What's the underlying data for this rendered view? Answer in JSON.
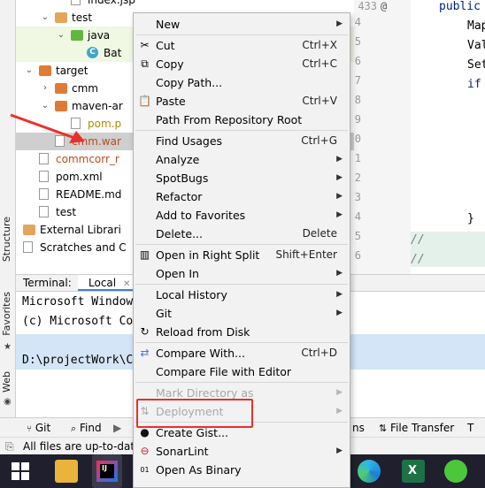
{
  "project_tree": {
    "items": [
      {
        "label": "index.jsp",
        "indent": 2,
        "icon": "jsp-file-icon",
        "expanded": null
      },
      {
        "label": "test",
        "indent": 1,
        "icon": "folder-icon",
        "expanded": true
      },
      {
        "label": "java",
        "indent": 2,
        "icon": "green-folder-icon",
        "expanded": true
      },
      {
        "label": "Bat",
        "indent": 3,
        "icon": "class-icon",
        "expanded": null
      },
      {
        "label": "target",
        "indent": 0,
        "icon": "orange-folder-icon",
        "expanded": true
      },
      {
        "label": "cmm",
        "indent": 1,
        "icon": "orange-folder-icon",
        "expanded": false
      },
      {
        "label": "maven-ar",
        "indent": 1,
        "icon": "orange-folder-icon",
        "expanded": true
      },
      {
        "label": "pom.p",
        "indent": 2,
        "icon": "properties-file-icon",
        "expanded": null
      },
      {
        "label": "cmm.war",
        "indent": 1,
        "icon": "war-file-icon",
        "expanded": null
      },
      {
        "label": "commcorr_r",
        "indent": 0,
        "icon": "module-file-icon",
        "expanded": null
      },
      {
        "label": "pom.xml",
        "indent": 0,
        "icon": "maven-file-icon",
        "expanded": null
      },
      {
        "label": "README.md",
        "indent": 0,
        "icon": "markdown-file-icon",
        "expanded": null
      },
      {
        "label": "test",
        "indent": 0,
        "icon": "file-icon",
        "expanded": null
      },
      {
        "label": "External Librari",
        "indent": -1,
        "icon": "library-icon",
        "expanded": false
      },
      {
        "label": "Scratches and C",
        "indent": -1,
        "icon": "scratch-icon",
        "expanded": false
      }
    ]
  },
  "left_strip": {
    "structure": "Structure",
    "favorites": "Favorites",
    "web": "Web"
  },
  "editor": {
    "line_numbers": [
      "433",
      "4",
      "5",
      "6",
      "7",
      "8",
      "9",
      "0",
      "1",
      "2",
      "3",
      "4",
      "5",
      "6"
    ],
    "code_lines": [
      "public",
      "Map",
      "Val",
      "Set",
      "if",
      "",
      "",
      "",
      "",
      "",
      "}",
      "//",
      "//"
    ]
  },
  "terminal": {
    "tab_label": "Terminal:",
    "local_tab": "Local",
    "lines": [
      "Microsoft Window",
      "(c) Microsoft Co",
      "",
      "D:\\projectWork\\C"
    ]
  },
  "bottom_toolbar": {
    "git": "Git",
    "find": "Find",
    "ns": "ns",
    "file_transfer": "File Transfer",
    "t": "T"
  },
  "status": {
    "text": "All files are up-to-dat"
  },
  "context_menu": {
    "items": [
      {
        "label": "New",
        "shortcut": "",
        "submenu": true,
        "icon": "",
        "disabled": false
      },
      {
        "label": "Cut",
        "shortcut": "Ctrl+X",
        "submenu": false,
        "icon": "cut-icon",
        "disabled": false
      },
      {
        "label": "Copy",
        "shortcut": "Ctrl+C",
        "submenu": false,
        "icon": "copy-icon",
        "disabled": false
      },
      {
        "label": "Copy Path...",
        "shortcut": "",
        "submenu": false,
        "icon": "",
        "disabled": false
      },
      {
        "label": "Paste",
        "shortcut": "Ctrl+V",
        "submenu": false,
        "icon": "paste-icon",
        "disabled": false
      },
      {
        "label": "Path From Repository Root",
        "shortcut": "",
        "submenu": false,
        "icon": "",
        "disabled": false
      },
      {
        "label": "Find Usages",
        "shortcut": "Ctrl+G",
        "submenu": false,
        "icon": "",
        "disabled": false
      },
      {
        "label": "Analyze",
        "shortcut": "",
        "submenu": true,
        "icon": "",
        "disabled": false
      },
      {
        "label": "SpotBugs",
        "shortcut": "",
        "submenu": true,
        "icon": "",
        "disabled": false
      },
      {
        "label": "Refactor",
        "shortcut": "",
        "submenu": true,
        "icon": "",
        "disabled": false
      },
      {
        "label": "Add to Favorites",
        "shortcut": "",
        "submenu": true,
        "icon": "",
        "disabled": false
      },
      {
        "label": "Delete...",
        "shortcut": "Delete",
        "submenu": false,
        "icon": "",
        "disabled": false
      },
      {
        "label": "Open in Right Split",
        "shortcut": "Shift+Enter",
        "submenu": false,
        "icon": "split-icon",
        "disabled": false
      },
      {
        "label": "Open In",
        "shortcut": "",
        "submenu": true,
        "icon": "",
        "disabled": false
      },
      {
        "label": "Local History",
        "shortcut": "",
        "submenu": true,
        "icon": "",
        "disabled": false
      },
      {
        "label": "Git",
        "shortcut": "",
        "submenu": true,
        "icon": "",
        "disabled": false
      },
      {
        "label": "Reload from Disk",
        "shortcut": "",
        "submenu": false,
        "icon": "reload-icon",
        "disabled": false
      },
      {
        "label": "Compare With...",
        "shortcut": "Ctrl+D",
        "submenu": false,
        "icon": "compare-icon",
        "disabled": false
      },
      {
        "label": "Compare File with Editor",
        "shortcut": "",
        "submenu": false,
        "icon": "",
        "disabled": false
      },
      {
        "label": "Mark Directory as",
        "shortcut": "",
        "submenu": true,
        "icon": "",
        "disabled": true
      },
      {
        "label": "Deployment",
        "shortcut": "",
        "submenu": true,
        "icon": "deployment-icon",
        "disabled": true
      },
      {
        "label": "Create Gist...",
        "shortcut": "",
        "submenu": false,
        "icon": "github-icon",
        "disabled": false
      },
      {
        "label": "SonarLint",
        "shortcut": "",
        "submenu": true,
        "icon": "sonarlint-icon",
        "disabled": false
      },
      {
        "label": "Open As Binary",
        "shortcut": "",
        "submenu": false,
        "icon": "binary-icon",
        "disabled": false
      }
    ]
  },
  "colors": {
    "menu_bg": "#f2f2f2",
    "selection": "#cfcfcf",
    "annotation": "#e8302a",
    "terminal_selection": "#d3e5f7"
  }
}
